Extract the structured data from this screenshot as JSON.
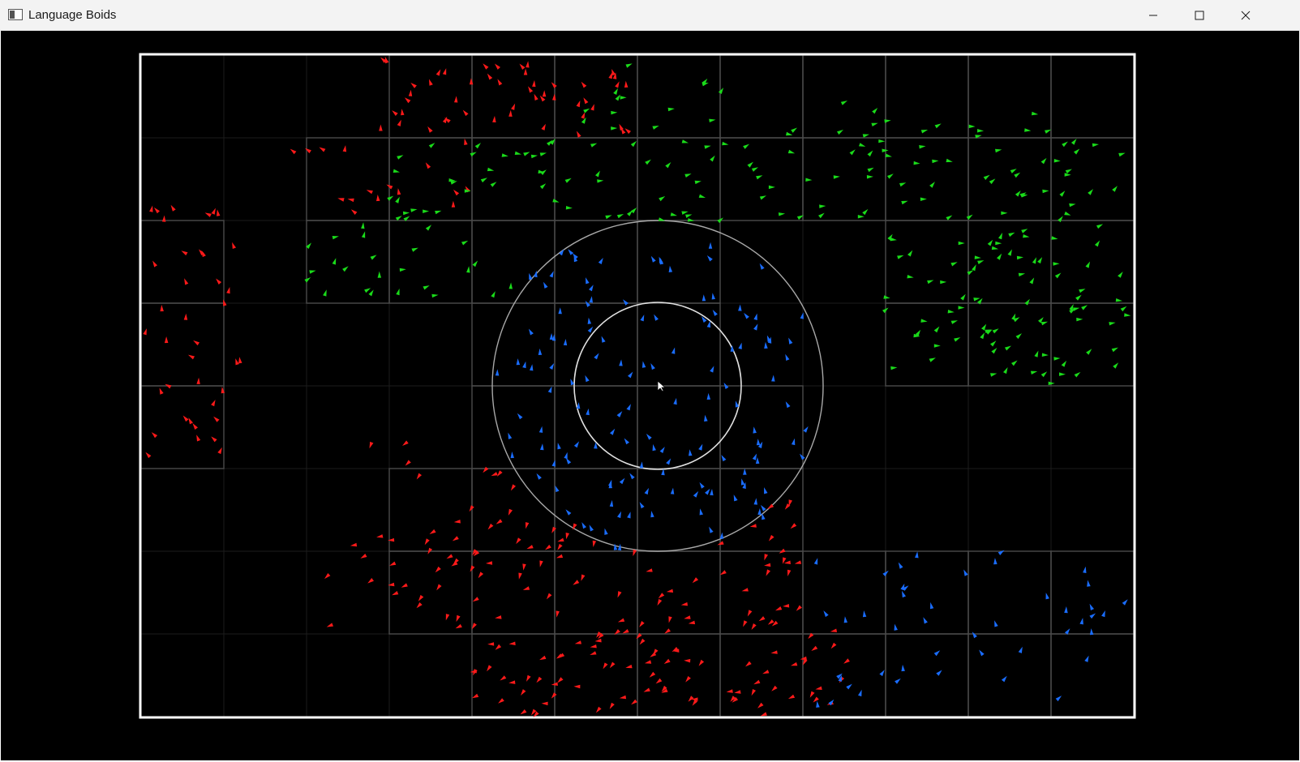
{
  "window": {
    "title": "Language Boids",
    "app_icon": "window-icon",
    "controls": [
      {
        "name": "minimize-button",
        "icon": "minimize-icon"
      },
      {
        "name": "maximize-button",
        "icon": "maximize-icon"
      },
      {
        "name": "close-button",
        "icon": "close-icon"
      }
    ]
  },
  "simulation": {
    "background_color": "#000000",
    "boundary_color": "#ffffff",
    "grid_line_color": "#4a4a4a",
    "grid_line_color_faint": "#1c1c1c",
    "influence_circle_color": "#a8a8a8",
    "cursor": "arrow-cursor",
    "groups": [
      {
        "name": "red",
        "color": "#ff1a1a"
      },
      {
        "name": "green",
        "color": "#1adb1a"
      },
      {
        "name": "blue",
        "color": "#1a6dff"
      }
    ]
  }
}
